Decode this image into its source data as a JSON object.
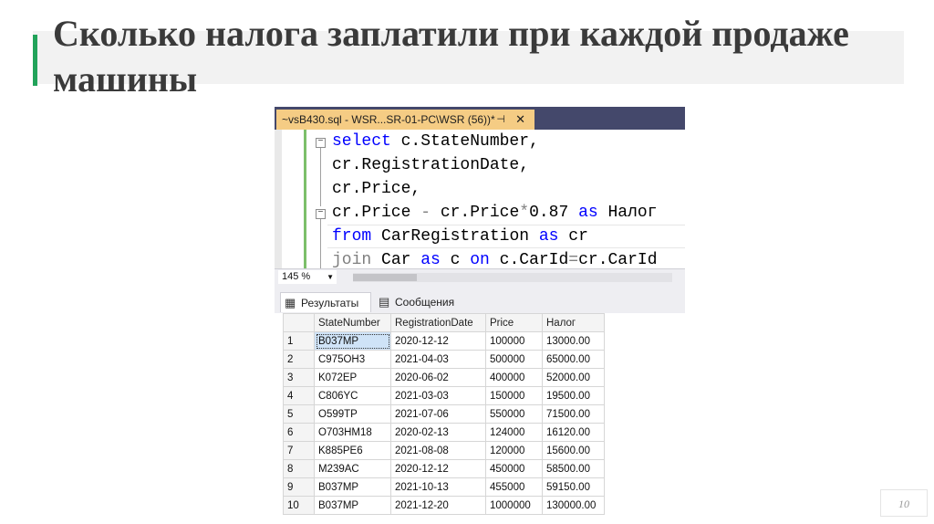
{
  "slide": {
    "title": "Сколько налога заплатили при каждой продаже машины",
    "page_number": "10",
    "accent_color": "#22a35a"
  },
  "editor": {
    "tab_title": "~vsB430.sql - WSR...SR-01-PC\\WSR (56))*",
    "tab_pin_icon": "pin-icon",
    "tab_close_icon": "close-icon",
    "code": {
      "l1_kw": "select",
      "l1_rest": " c.StateNumber,",
      "l2": "cr.RegistrationDate,",
      "l3": "cr.Price,",
      "l4_a": "cr.Price ",
      "l4_minus": "-",
      "l4_b": " cr.Price",
      "l4_star": "*",
      "l4_c": "0.87 ",
      "l4_as": "as",
      "l4_d": " Налог",
      "l5_kw": "from",
      "l5_a": " CarRegistration ",
      "l5_as": "as",
      "l5_b": " cr",
      "l6_kw": "join",
      "l6_a": " Car ",
      "l6_as": "as",
      "l6_b": " c ",
      "l6_on": "on",
      "l6_c": " c.CarId",
      "l6_eq": "=",
      "l6_d": "cr.CarId"
    },
    "zoom": "145 %"
  },
  "results": {
    "tab_results": "Результаты",
    "tab_messages": "Сообщения",
    "columns": [
      "StateNumber",
      "RegistrationDate",
      "Price",
      "Налог"
    ],
    "rows": [
      [
        "1",
        "B037MP",
        "2020-12-12",
        "100000",
        "13000.00"
      ],
      [
        "2",
        "C975OH3",
        "2021-04-03",
        "500000",
        "65000.00"
      ],
      [
        "3",
        "K072EP",
        "2020-06-02",
        "400000",
        "52000.00"
      ],
      [
        "4",
        "C806YC",
        "2021-03-03",
        "150000",
        "19500.00"
      ],
      [
        "5",
        "O599TP",
        "2021-07-06",
        "550000",
        "71500.00"
      ],
      [
        "6",
        "O703HM18",
        "2020-02-13",
        "124000",
        "16120.00"
      ],
      [
        "7",
        "K885PE6",
        "2021-08-08",
        "120000",
        "15600.00"
      ],
      [
        "8",
        "M239AC",
        "2020-12-12",
        "450000",
        "58500.00"
      ],
      [
        "9",
        "B037MP",
        "2021-10-13",
        "455000",
        "59150.00"
      ],
      [
        "10",
        "B037MP",
        "2021-12-20",
        "1000000",
        "130000.00"
      ]
    ]
  }
}
